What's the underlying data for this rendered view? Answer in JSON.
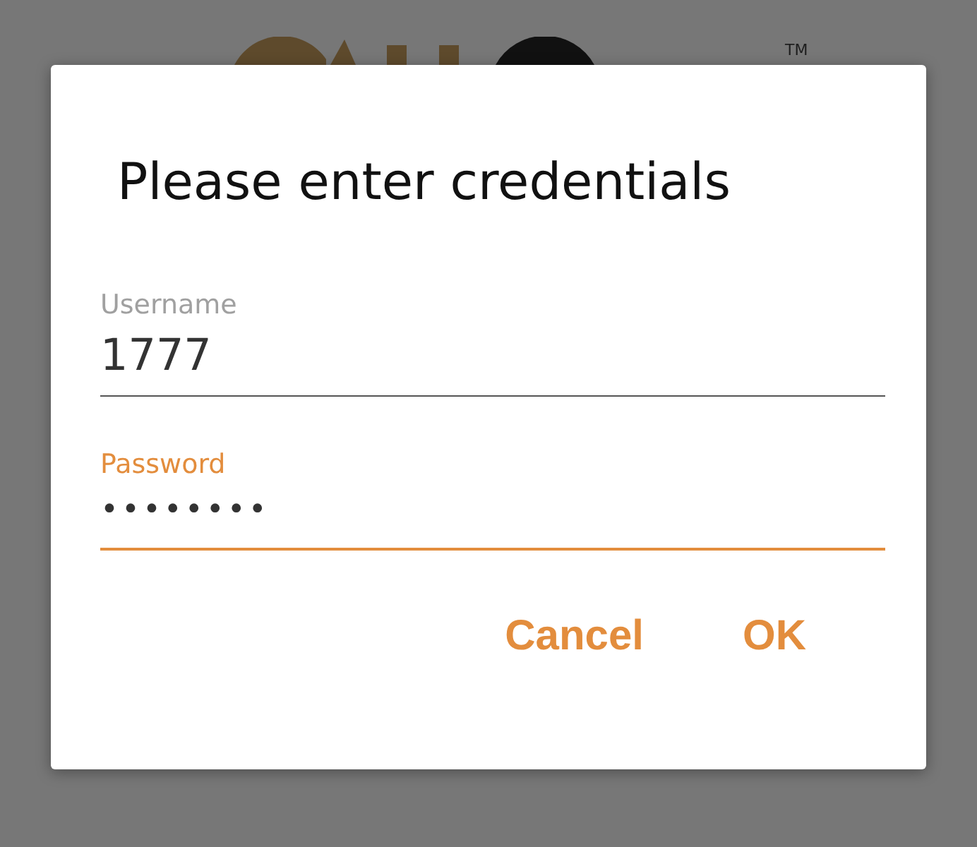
{
  "background": {
    "trademark": "TM"
  },
  "dialog": {
    "title": "Please enter credentials",
    "fields": [
      {
        "label": "Username",
        "value": "1777",
        "focused": false
      },
      {
        "label": "Password",
        "value": "••••••••",
        "focused": true
      }
    ],
    "buttons": [
      "Cancel",
      "OK"
    ]
  }
}
